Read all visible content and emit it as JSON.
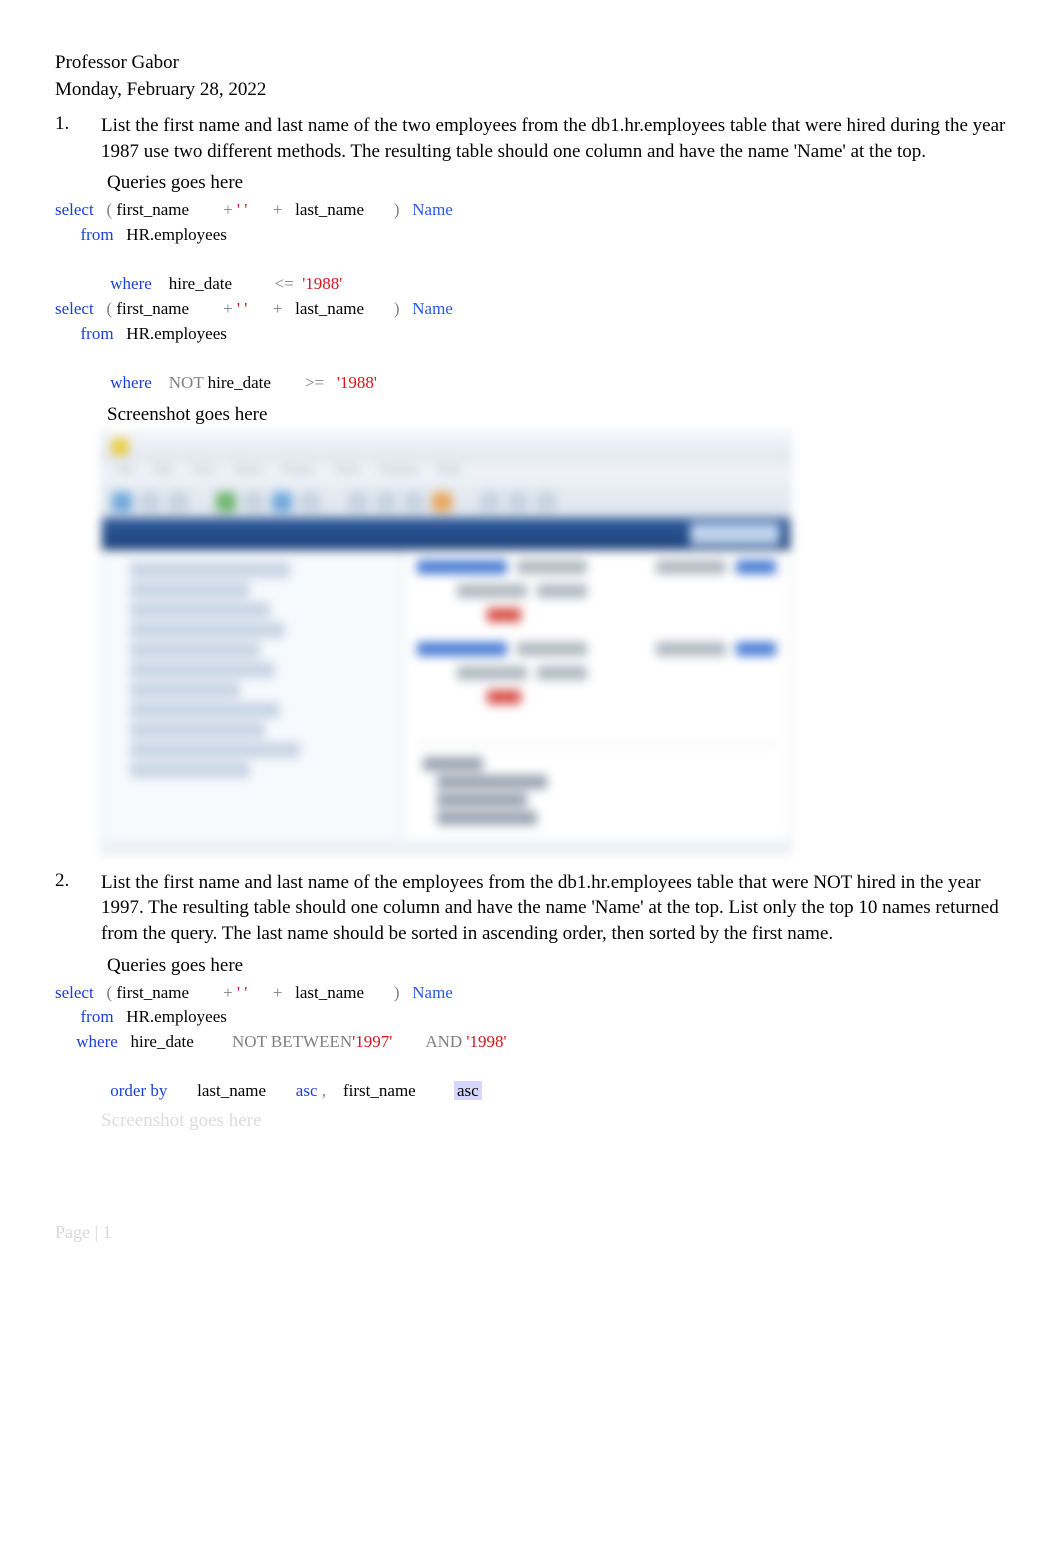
{
  "header": {
    "professor": "Professor Gabor",
    "date": "Monday, February 28, 2022"
  },
  "questions": [
    {
      "number": "1.",
      "text": "List the first name and last name of the two employees from the db1.hr.employees table that were hired during the year 1987 use two different methods. The resulting table should one column and have the name 'Name' at the top.",
      "queries_label": "Queries goes here",
      "screenshot_label": "Screenshot goes here",
      "queries": [
        {
          "tokens": [
            {
              "t": "select",
              "cls": "kw"
            },
            {
              "t": "   "
            },
            {
              "t": "(",
              "cls": "gray"
            },
            {
              "t": " first_name        "
            },
            {
              "t": "+",
              "cls": "gray"
            },
            {
              "t": " "
            },
            {
              "t": "' '",
              "cls": "str"
            },
            {
              "t": "      "
            },
            {
              "t": "+",
              "cls": "gray"
            },
            {
              "t": "   last_name       "
            },
            {
              "t": ")",
              "cls": "gray"
            },
            {
              "t": "   "
            },
            {
              "t": "Name",
              "cls": "alias"
            }
          ]
        },
        {
          "tokens": [
            {
              "t": "      "
            },
            {
              "t": "from",
              "cls": "kw"
            },
            {
              "t": "   HR",
              "cls": ""
            },
            {
              "t": "."
            },
            {
              "t": "employees"
            }
          ]
        },
        {
          "tokens": [
            {
              "t": " "
            }
          ]
        },
        {
          "tokens": [
            {
              "t": "             "
            },
            {
              "t": "where",
              "cls": "kw"
            },
            {
              "t": "    hire_date          "
            },
            {
              "t": "<=",
              "cls": "gray"
            },
            {
              "t": "  "
            },
            {
              "t": "'1988'",
              "cls": "str"
            }
          ]
        },
        {
          "tokens": [
            {
              "t": "select",
              "cls": "kw"
            },
            {
              "t": "   "
            },
            {
              "t": "(",
              "cls": "gray"
            },
            {
              "t": " first_name        "
            },
            {
              "t": "+",
              "cls": "gray"
            },
            {
              "t": " "
            },
            {
              "t": "' '",
              "cls": "str"
            },
            {
              "t": "      "
            },
            {
              "t": "+",
              "cls": "gray"
            },
            {
              "t": "   last_name       "
            },
            {
              "t": ")",
              "cls": "gray"
            },
            {
              "t": "   "
            },
            {
              "t": "Name",
              "cls": "alias"
            }
          ]
        },
        {
          "tokens": [
            {
              "t": "      "
            },
            {
              "t": "from",
              "cls": "kw"
            },
            {
              "t": "   HR"
            },
            {
              "t": "."
            },
            {
              "t": "employees"
            }
          ]
        },
        {
          "tokens": [
            {
              "t": " "
            }
          ]
        },
        {
          "tokens": [
            {
              "t": "             "
            },
            {
              "t": "where",
              "cls": "kw"
            },
            {
              "t": "    "
            },
            {
              "t": "NOT",
              "cls": "gray"
            },
            {
              "t": " hire_date        "
            },
            {
              "t": ">=",
              "cls": "gray"
            },
            {
              "t": "   "
            },
            {
              "t": "'1988'",
              "cls": "str"
            }
          ]
        }
      ]
    },
    {
      "number": "2.",
      "text": "List the first name and last name of the employees from the db1.hr.employees table that were NOT hired in the year 1997. The resulting table should one column and have the name 'Name' at the top. List only the top 10 names returned from the query. The last name should be sorted in ascending order, then sorted by the first name.",
      "queries_label": "Queries goes here",
      "screenshot_label": "Screenshot goes here",
      "queries": [
        {
          "tokens": [
            {
              "t": "select",
              "cls": "kw"
            },
            {
              "t": "   "
            },
            {
              "t": "(",
              "cls": "gray"
            },
            {
              "t": " first_name        "
            },
            {
              "t": "+",
              "cls": "gray"
            },
            {
              "t": " "
            },
            {
              "t": "' '",
              "cls": "str"
            },
            {
              "t": "      "
            },
            {
              "t": "+",
              "cls": "gray"
            },
            {
              "t": "   last_name       "
            },
            {
              "t": ")",
              "cls": "gray"
            },
            {
              "t": "   "
            },
            {
              "t": "Name",
              "cls": "alias"
            }
          ]
        },
        {
          "tokens": [
            {
              "t": "      "
            },
            {
              "t": "from",
              "cls": "kw"
            },
            {
              "t": "   HR"
            },
            {
              "t": "."
            },
            {
              "t": "employees"
            }
          ]
        },
        {
          "tokens": [
            {
              "t": "     "
            },
            {
              "t": "where",
              "cls": "kw"
            },
            {
              "t": "   hire_date         "
            },
            {
              "t": "NOT BETWEEN",
              "cls": "gray"
            },
            {
              "t": "'1997'",
              "cls": "str"
            },
            {
              "t": "        "
            },
            {
              "t": "AND",
              "cls": "gray"
            },
            {
              "t": " "
            },
            {
              "t": "'1998'",
              "cls": "str"
            }
          ]
        },
        {
          "tokens": [
            {
              "t": " "
            }
          ]
        },
        {
          "tokens": [
            {
              "t": "             "
            },
            {
              "t": "order by",
              "cls": "kw"
            },
            {
              "t": "       last_name       "
            },
            {
              "t": "asc",
              "cls": "kw"
            },
            {
              "t": " "
            },
            {
              "t": ",",
              "cls": "comma"
            },
            {
              "t": "    first_name         "
            },
            {
              "t": "asc",
              "cls": "hl"
            }
          ]
        }
      ]
    }
  ],
  "footer": {
    "page": "Page | 1"
  }
}
